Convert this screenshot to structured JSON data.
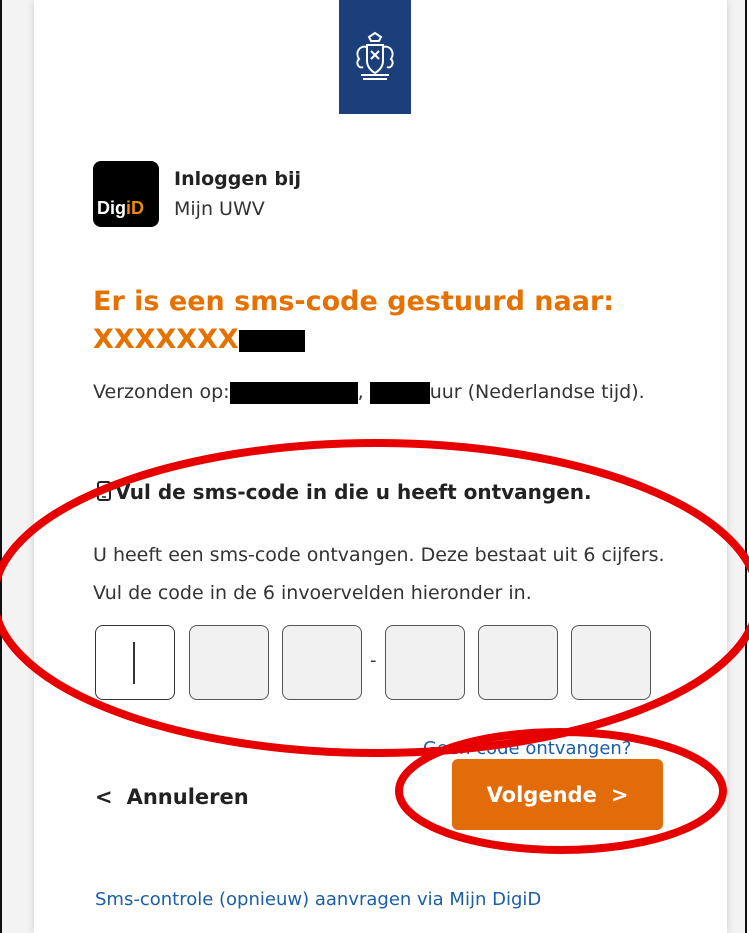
{
  "brand": {
    "digid_part1": "Dig",
    "digid_part2": "iD",
    "logo_name": "rijksoverheid-coat-of-arms",
    "navy": "#1b3f7a",
    "orange": "#e57200"
  },
  "login": {
    "title": "Inloggen bij",
    "service": "Mijn UWV"
  },
  "heading": {
    "line1": "Er is een sms-code gestuurd naar:",
    "masked_number": "XXXXXXX"
  },
  "sent": {
    "prefix": "Verzonden op:",
    "comma": ",",
    "suffix": "uur (Nederlandse tijd)."
  },
  "instruction": {
    "icon": "phone-icon",
    "title": "Vul de sms-code in die u heeft ontvangen.",
    "body": "U heeft een sms-code ontvangen. Deze bestaat uit 6 cijfers. Vul de code in de 6 invoervelden hieronder in."
  },
  "code": {
    "digits": [
      "",
      "",
      "",
      "",
      "",
      ""
    ],
    "separator": "-"
  },
  "links": {
    "no_code": "Geen code ontvangen?",
    "sms_request": "Sms-controle (opnieuw) aanvragen via Mijn DigiD"
  },
  "buttons": {
    "cancel_icon": "<",
    "cancel": "Annuleren",
    "next": "Volgende",
    "next_icon": ">"
  },
  "annotation": {
    "color": "#e60000"
  }
}
